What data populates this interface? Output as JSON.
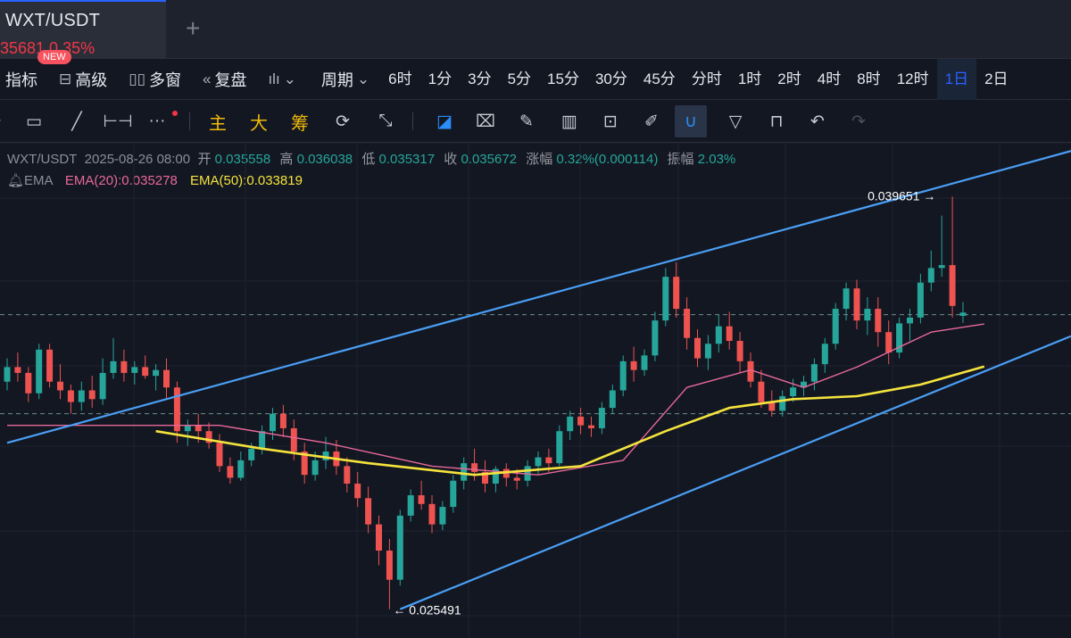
{
  "tab": {
    "symbol": "WXT/USDT",
    "price": "35681  0.35%",
    "badge": "NEW",
    "add": "+"
  },
  "toolbar": {
    "indicators": "指标",
    "advanced": "高级",
    "multi": "多窗",
    "replay": "复盘",
    "period": "周期",
    "intervals": [
      "6时",
      "1分",
      "3分",
      "5分",
      "15分",
      "30分",
      "45分",
      "分时",
      "1时",
      "2时",
      "4时",
      "8时",
      "12时",
      "1日",
      "2日"
    ],
    "active_interval": "1日"
  },
  "drawing_tools": {
    "main": "主",
    "big": "大",
    "chips": "筹"
  },
  "legend": {
    "symbol": "WXT/USDT",
    "datetime": "2025-08-26 08:00",
    "open_label": "开",
    "open": "0.035558",
    "high_label": "高",
    "high": "0.036038",
    "low_label": "低",
    "low": "0.035317",
    "close_label": "收",
    "close": "0.035672",
    "change_label": "涨幅",
    "change": "0.32%(0.000114)",
    "amp_label": "振幅",
    "amp": "2.03%",
    "ema_name": "EMA",
    "ema20": "EMA(20):0.035278",
    "ema50": "EMA(50):0.033819"
  },
  "colors": {
    "up": "#26a69a",
    "down": "#ef5350",
    "ema20": "#e8689a",
    "ema50": "#f5e33d",
    "channel": "#4a9ff5",
    "accent": "#2962ff"
  },
  "chart_data": {
    "type": "candlestick",
    "symbol": "WXT/USDT",
    "y_range": [
      0.0245,
      0.0415
    ],
    "high_marker": "0.039651",
    "low_marker": "0.025491",
    "dashed_levels": [
      0.0356,
      0.0322
    ],
    "channel": {
      "upper": [
        [
          0,
          0.0312
        ],
        [
          92,
          0.0404
        ]
      ],
      "lower": [
        [
          37,
          0.02549
        ],
        [
          92,
          0.03365
        ]
      ]
    },
    "candles": [
      [
        0.0333,
        0.0341,
        0.033,
        0.0338
      ],
      [
        0.0338,
        0.0343,
        0.0333,
        0.0336
      ],
      [
        0.0336,
        0.0338,
        0.0326,
        0.0329
      ],
      [
        0.0329,
        0.0346,
        0.0327,
        0.0344
      ],
      [
        0.0344,
        0.0346,
        0.0331,
        0.0333
      ],
      [
        0.0333,
        0.0339,
        0.0327,
        0.033
      ],
      [
        0.033,
        0.0332,
        0.0322,
        0.0326
      ],
      [
        0.0326,
        0.0333,
        0.0323,
        0.033
      ],
      [
        0.033,
        0.0335,
        0.0324,
        0.0327
      ],
      [
        0.0327,
        0.0341,
        0.0325,
        0.0336
      ],
      [
        0.0336,
        0.0348,
        0.0334,
        0.034
      ],
      [
        0.034,
        0.0344,
        0.0333,
        0.0336
      ],
      [
        0.0336,
        0.034,
        0.0332,
        0.0338
      ],
      [
        0.0338,
        0.0342,
        0.0334,
        0.0335
      ],
      [
        0.0335,
        0.0339,
        0.033,
        0.0337
      ],
      [
        0.0337,
        0.0341,
        0.0327,
        0.0331
      ],
      [
        0.0331,
        0.0333,
        0.0312,
        0.0316
      ],
      [
        0.0316,
        0.032,
        0.0311,
        0.0318
      ],
      [
        0.0318,
        0.0322,
        0.0312,
        0.0316
      ],
      [
        0.0316,
        0.0319,
        0.031,
        0.0312
      ],
      [
        0.0312,
        0.0315,
        0.0302,
        0.0304
      ],
      [
        0.0304,
        0.0307,
        0.0298,
        0.03
      ],
      [
        0.03,
        0.0309,
        0.0299,
        0.0306
      ],
      [
        0.0306,
        0.0312,
        0.0304,
        0.031
      ],
      [
        0.031,
        0.0318,
        0.0308,
        0.0316
      ],
      [
        0.0316,
        0.0324,
        0.0313,
        0.0322
      ],
      [
        0.0322,
        0.0325,
        0.0314,
        0.0317
      ],
      [
        0.0317,
        0.032,
        0.0306,
        0.0309
      ],
      [
        0.0309,
        0.0312,
        0.0298,
        0.0301
      ],
      [
        0.0301,
        0.0309,
        0.0299,
        0.0306
      ],
      [
        0.0306,
        0.0314,
        0.0303,
        0.0309
      ],
      [
        0.0309,
        0.0313,
        0.0301,
        0.0304
      ],
      [
        0.0304,
        0.0307,
        0.0295,
        0.0298
      ],
      [
        0.0298,
        0.0302,
        0.029,
        0.0293
      ],
      [
        0.0293,
        0.0297,
        0.0281,
        0.0284
      ],
      [
        0.0284,
        0.0287,
        0.027,
        0.0275
      ],
      [
        0.0275,
        0.0279,
        0.02549,
        0.0265
      ],
      [
        0.0265,
        0.0289,
        0.0263,
        0.0287
      ],
      [
        0.0287,
        0.0296,
        0.0285,
        0.0294
      ],
      [
        0.0294,
        0.0299,
        0.0289,
        0.0291
      ],
      [
        0.0291,
        0.0294,
        0.0281,
        0.0284
      ],
      [
        0.0284,
        0.0292,
        0.0282,
        0.029
      ],
      [
        0.029,
        0.0301,
        0.0288,
        0.0299
      ],
      [
        0.0299,
        0.0307,
        0.0296,
        0.0305
      ],
      [
        0.0305,
        0.031,
        0.0299,
        0.0302
      ],
      [
        0.0302,
        0.0306,
        0.0295,
        0.0298
      ],
      [
        0.0298,
        0.0304,
        0.0295,
        0.0303
      ],
      [
        0.0303,
        0.0305,
        0.0297,
        0.03
      ],
      [
        0.03,
        0.0303,
        0.0296,
        0.0299
      ],
      [
        0.0299,
        0.0306,
        0.0297,
        0.0304
      ],
      [
        0.0304,
        0.0309,
        0.0301,
        0.0307
      ],
      [
        0.0307,
        0.031,
        0.0302,
        0.0305
      ],
      [
        0.0305,
        0.0318,
        0.0304,
        0.0316
      ],
      [
        0.0316,
        0.0323,
        0.0313,
        0.0321
      ],
      [
        0.0321,
        0.0324,
        0.0315,
        0.0318
      ],
      [
        0.0318,
        0.0321,
        0.0314,
        0.0317
      ],
      [
        0.0317,
        0.0326,
        0.0315,
        0.0324
      ],
      [
        0.0324,
        0.0332,
        0.0322,
        0.033
      ],
      [
        0.033,
        0.0342,
        0.0328,
        0.034
      ],
      [
        0.034,
        0.0345,
        0.0333,
        0.0337
      ],
      [
        0.0337,
        0.0344,
        0.0335,
        0.0342
      ],
      [
        0.0342,
        0.0357,
        0.034,
        0.0354
      ],
      [
        0.0354,
        0.0372,
        0.0352,
        0.0369
      ],
      [
        0.0369,
        0.0374,
        0.0355,
        0.0358
      ],
      [
        0.0358,
        0.0362,
        0.0344,
        0.0348
      ],
      [
        0.0348,
        0.0351,
        0.0338,
        0.0341
      ],
      [
        0.0341,
        0.0349,
        0.0337,
        0.0346
      ],
      [
        0.0346,
        0.0356,
        0.0343,
        0.0352
      ],
      [
        0.0352,
        0.0357,
        0.0344,
        0.0347
      ],
      [
        0.0347,
        0.035,
        0.0336,
        0.034
      ],
      [
        0.034,
        0.0343,
        0.0331,
        0.0333
      ],
      [
        0.0333,
        0.0337,
        0.0324,
        0.0326
      ],
      [
        0.0326,
        0.033,
        0.0321,
        0.0323
      ],
      [
        0.0323,
        0.033,
        0.0321,
        0.0328
      ],
      [
        0.0328,
        0.0334,
        0.0326,
        0.0331
      ],
      [
        0.0331,
        0.0335,
        0.0328,
        0.0333
      ],
      [
        0.0333,
        0.0341,
        0.033,
        0.0339
      ],
      [
        0.0339,
        0.0348,
        0.0336,
        0.0346
      ],
      [
        0.0346,
        0.036,
        0.0344,
        0.0358
      ],
      [
        0.0358,
        0.0367,
        0.0354,
        0.0365
      ],
      [
        0.0365,
        0.0368,
        0.0351,
        0.0354
      ],
      [
        0.0354,
        0.0362,
        0.0349,
        0.0358
      ],
      [
        0.0358,
        0.0362,
        0.0345,
        0.035
      ],
      [
        0.035,
        0.0354,
        0.0339,
        0.0343
      ],
      [
        0.0343,
        0.0355,
        0.0341,
        0.0353
      ],
      [
        0.0353,
        0.0358,
        0.0347,
        0.0355
      ],
      [
        0.0355,
        0.037,
        0.0353,
        0.0367
      ],
      [
        0.0367,
        0.0378,
        0.0364,
        0.0372
      ],
      [
        0.0372,
        0.039,
        0.0369,
        0.0373
      ],
      [
        0.0373,
        0.03965,
        0.0355,
        0.0359
      ],
      [
        0.035558,
        0.036038,
        0.035317,
        0.035672
      ]
    ],
    "ema20": [
      [
        0,
        0.0318
      ],
      [
        20,
        0.0318
      ],
      [
        30,
        0.0312
      ],
      [
        40,
        0.0304
      ],
      [
        50,
        0.0301
      ],
      [
        58,
        0.0306
      ],
      [
        64,
        0.0331
      ],
      [
        70,
        0.0337
      ],
      [
        75,
        0.0331
      ],
      [
        80,
        0.0338
      ],
      [
        87,
        0.035
      ],
      [
        92,
        0.03528
      ]
    ],
    "ema50": [
      [
        14,
        0.0316
      ],
      [
        24,
        0.031
      ],
      [
        34,
        0.0305
      ],
      [
        44,
        0.0301
      ],
      [
        54,
        0.0304
      ],
      [
        62,
        0.0316
      ],
      [
        68,
        0.0324
      ],
      [
        74,
        0.0327
      ],
      [
        80,
        0.0328
      ],
      [
        86,
        0.0332
      ],
      [
        92,
        0.03382
      ]
    ]
  }
}
